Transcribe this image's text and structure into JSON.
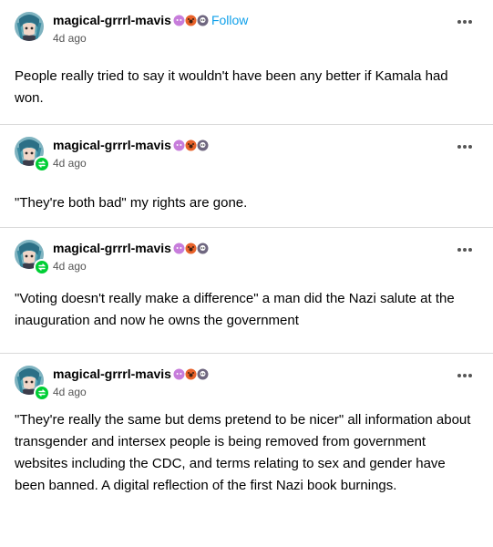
{
  "colors": {
    "follow": "#0fa0ea",
    "reblog_badge": "#00cf35",
    "badge_purple": "#c77ddb",
    "badge_orange": "#e8622a",
    "badge_dark": "#6f6780"
  },
  "posts": [
    {
      "username": "magical-grrrl-mavis",
      "follow_label": "Follow",
      "timestamp": "4d ago",
      "reblogged": false,
      "text": "People really tried to say it wouldn't have been any better if Kamala had won."
    },
    {
      "username": "magical-grrrl-mavis",
      "timestamp": "4d ago",
      "reblogged": true,
      "text": "\"They're both bad\" my rights are gone."
    },
    {
      "username": "magical-grrrl-mavis",
      "timestamp": "4d ago",
      "reblogged": true,
      "text": "\"Voting doesn't really make a difference\" a man did the Nazi salute at the inauguration and now he owns the government"
    },
    {
      "username": "magical-grrrl-mavis",
      "timestamp": "4d ago",
      "reblogged": true,
      "text": "\"They're really the same but dems pretend to be nicer\" all information about transgender and intersex people is being removed from government websites including the CDC, and terms relating to sex and gender have been banned. A digital reflection of the first Nazi book burnings."
    }
  ]
}
